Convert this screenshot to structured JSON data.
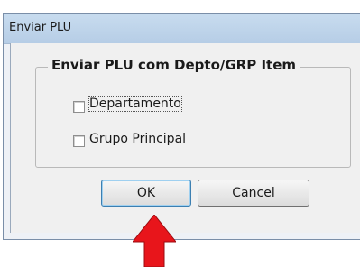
{
  "dialog": {
    "title": "Enviar PLU",
    "group_title": "Enviar PLU com Depto/GRP Item",
    "options": [
      {
        "label": "Departamento",
        "checked": false
      },
      {
        "label": "Grupo Principal",
        "checked": false
      }
    ],
    "buttons": {
      "ok": "OK",
      "cancel": "Cancel"
    }
  },
  "annotation": {
    "arrow_color": "#e8151b"
  }
}
